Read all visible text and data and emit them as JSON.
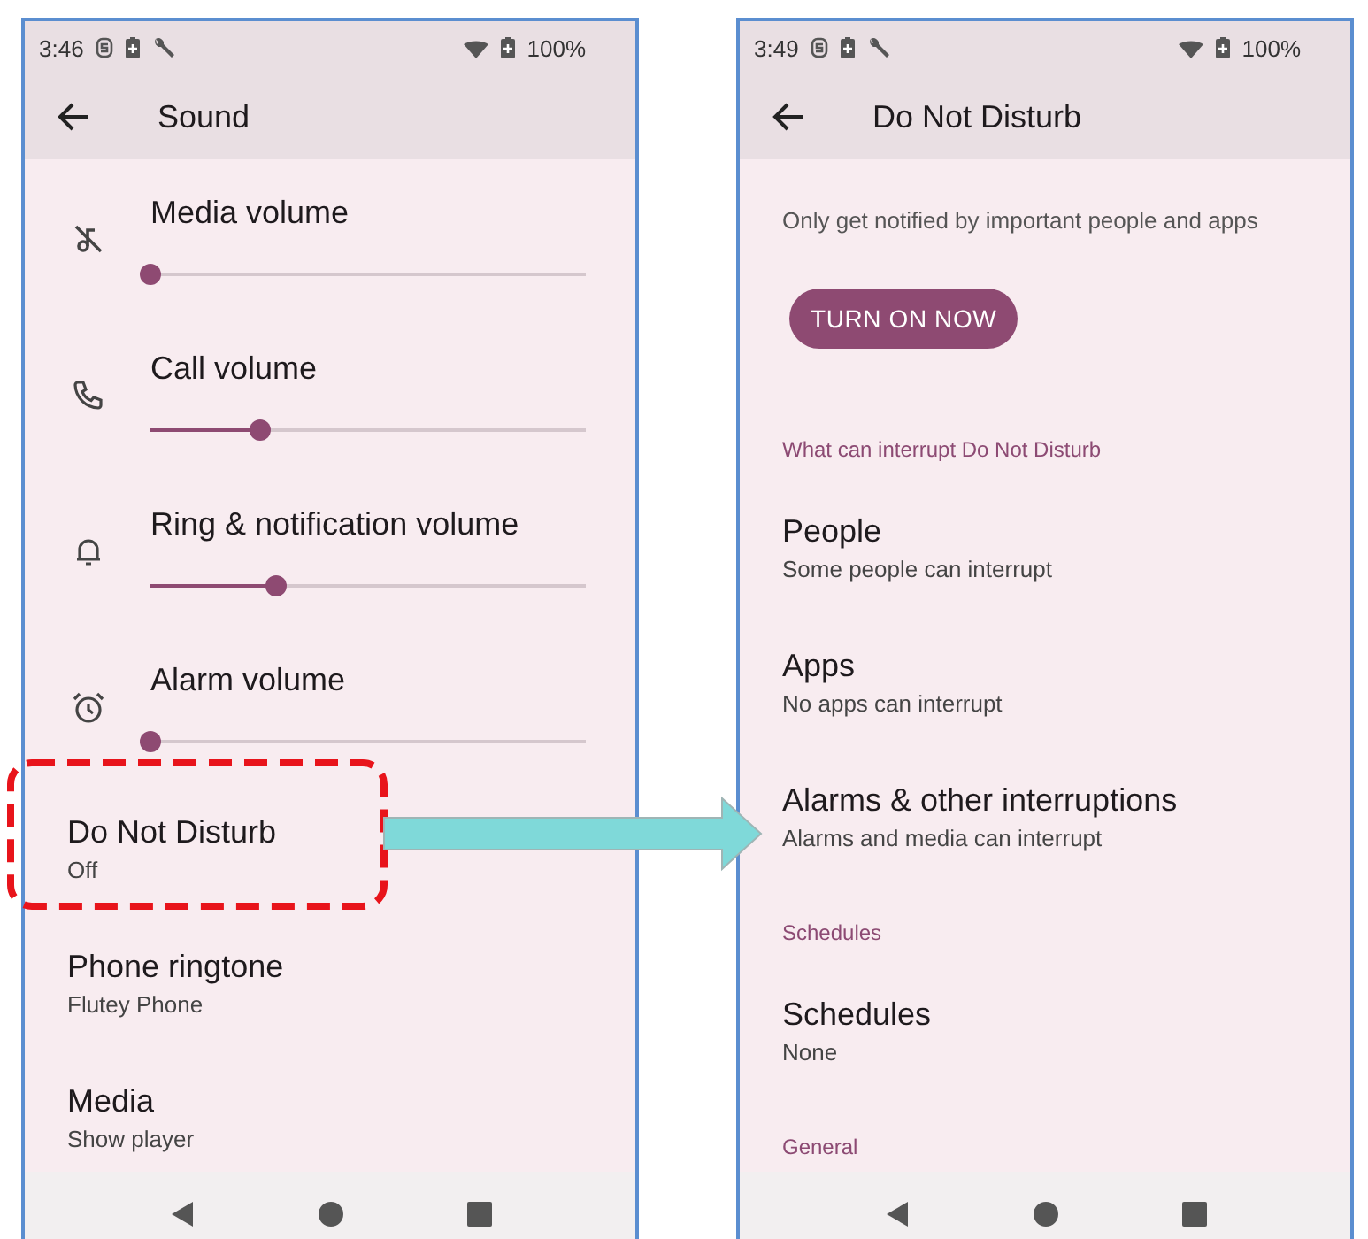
{
  "screens": [
    {
      "status_bar": {
        "time": "3:46",
        "battery": "100%"
      },
      "title": "Sound",
      "rows": [
        {
          "kind": "slider",
          "label": "Media volume",
          "level": 0
        },
        {
          "kind": "slider",
          "label": "Call volume",
          "level": 0.25
        },
        {
          "kind": "slider",
          "label": "Ring & notification volume",
          "level": 0.29
        },
        {
          "kind": "slider",
          "label": "Alarm volume",
          "level": 0
        },
        {
          "kind": "item",
          "title": "Do Not Disturb",
          "subtitle": "Off"
        },
        {
          "kind": "item",
          "title": "Phone ringtone",
          "subtitle": "Flutey Phone"
        },
        {
          "kind": "item",
          "title": "Media",
          "subtitle": "Show player"
        }
      ]
    },
    {
      "status_bar": {
        "time": "3:49",
        "battery": "100%"
      },
      "title": "Do Not Disturb",
      "rows": [
        {
          "kind": "text",
          "text": "Only get notified by important people and apps"
        },
        {
          "kind": "button",
          "label": "TURN ON NOW"
        },
        {
          "kind": "header",
          "text": "What can interrupt Do Not Disturb"
        },
        {
          "kind": "item",
          "title": "People",
          "subtitle": "Some people can interrupt"
        },
        {
          "kind": "item",
          "title": "Apps",
          "subtitle": "No apps can interrupt"
        },
        {
          "kind": "item",
          "title": "Alarms & other interruptions",
          "subtitle": "Alarms and media can interrupt"
        },
        {
          "kind": "header",
          "text": "Schedules"
        },
        {
          "kind": "item",
          "title": "Schedules",
          "subtitle": "None"
        },
        {
          "kind": "header",
          "text": "General"
        }
      ]
    }
  ]
}
